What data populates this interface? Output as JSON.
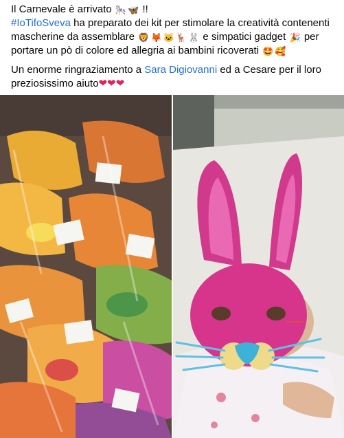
{
  "post": {
    "line1": "Il Carnevale è arrivato",
    "line1_tail": "!!",
    "hashtag": "#IoTifoSveva",
    "line2a": " ha preparato dei kit per stimolare la creatività contenenti",
    "line3a": "mascherine  da assemblare",
    "line3b": "e simpatici gadget",
    "line3c": "per",
    "line4": "portare un pò di colore ed allegria ai bambini ricoverati",
    "thanks_a": "Un enorme ringraziamento a ",
    "mention": "Sara Digiovanni",
    "thanks_b": " ed a Cesare per il loro",
    "thanks_c": "preziosissimo aiuto"
  },
  "emoji": {
    "line1": [
      "🎠",
      "🦋"
    ],
    "animals": [
      "🦁",
      "🦊",
      "🐱",
      "🦌",
      "🐰"
    ],
    "party": "🎉",
    "faces": [
      "🤩",
      "🥰"
    ],
    "hearts": [
      "❤",
      "❤",
      "❤"
    ]
  },
  "colors": {
    "link": "#216fdb",
    "text": "#050505",
    "heart": "#e0245e"
  },
  "photos": [
    {
      "name": "kits photo"
    },
    {
      "name": "child with bunny mask photo"
    }
  ]
}
